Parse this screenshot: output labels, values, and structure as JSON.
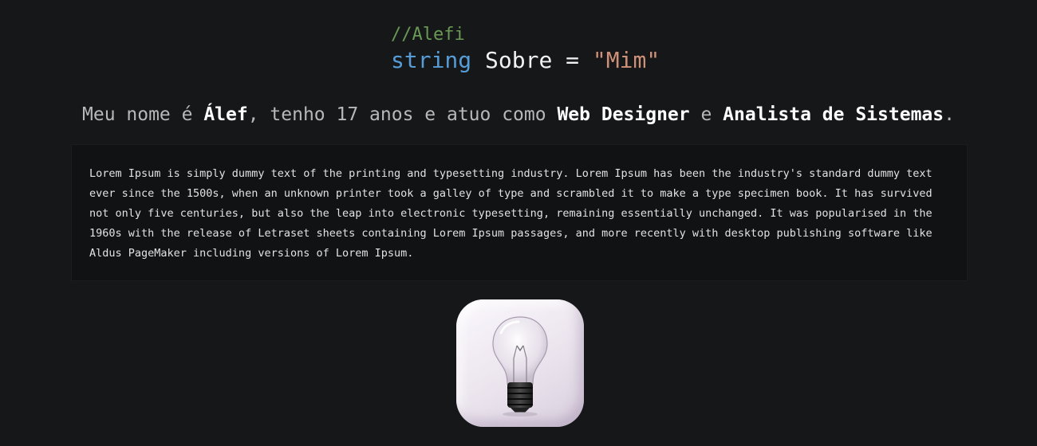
{
  "code": {
    "comment": "//Alefi",
    "keyword": "string",
    "identifier": "Sobre",
    "operator": "=",
    "string_value": "\"Mim\""
  },
  "intro": {
    "part1": "Meu nome é ",
    "name": "Álef",
    "part2": ", tenho 17 anos e atuo como ",
    "role1": "Web Designer",
    "part3": " e ",
    "role2": "Analista de Sistemas",
    "part4": "."
  },
  "bio": {
    "text": "Lorem Ipsum is simply dummy text of the printing and typesetting industry. Lorem Ipsum has been the industry's standard dummy text ever since the 1500s, when an unknown printer took a galley of type and scrambled it to make a type specimen book. It has survived not only five centuries, but also the leap into electronic typesetting, remaining essentially unchanged. It was popularised in the 1960s with the release of Letraset sheets containing Lorem Ipsum passages, and more recently with desktop publishing software like Aldus PageMaker including versions of Lorem Ipsum."
  },
  "illustration": {
    "icon": "lightbulb-icon"
  },
  "colors": {
    "background": "#161719",
    "comment": "#6a9955",
    "keyword": "#569cd6",
    "string": "#ce9178",
    "text_bright": "#ffffff",
    "text_muted": "#b8b8b8"
  }
}
